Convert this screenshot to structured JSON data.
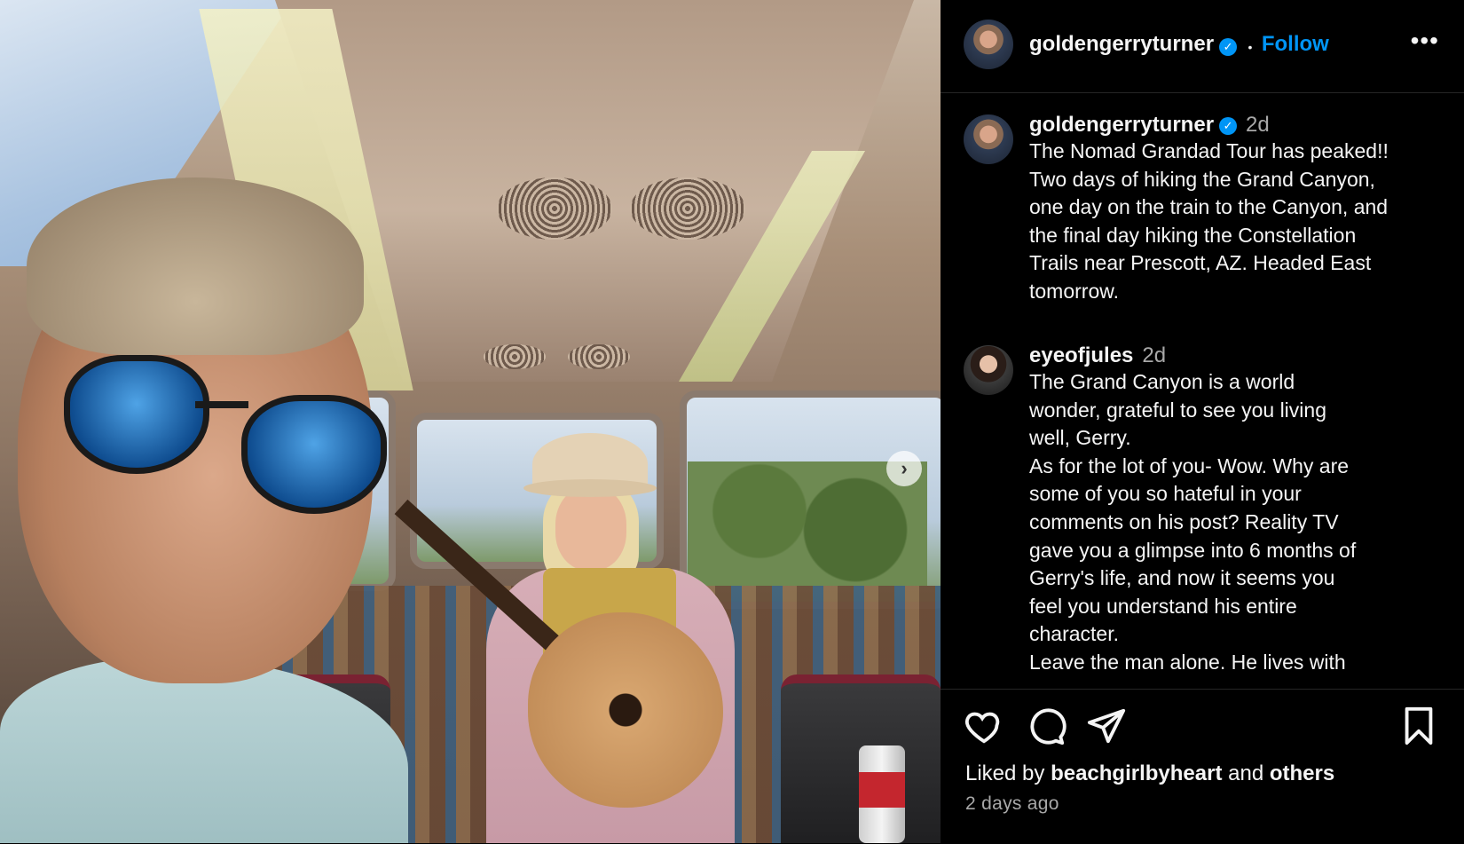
{
  "header": {
    "username": "goldengerryturner",
    "follow_label": "Follow",
    "separator": "•",
    "more_label": "•••"
  },
  "post": {
    "caption": {
      "username": "goldengerryturner",
      "time": "2d",
      "text": "The Nomad Grandad Tour has peaked!!\nTwo days of hiking the Grand Canyon,\none day on the train to the Canyon, and\nthe final day hiking the Constellation\nTrails near Prescott, AZ. Headed East\ntomorrow."
    },
    "comment": {
      "username": "eyeofjules",
      "time": "2d",
      "text": "The Grand Canyon is a world\nwonder, grateful to see you living\nwell, Gerry.\nAs for the lot of you- Wow. Why are\nsome of you so hateful in your\ncomments on his post? Reality TV\ngave you a glimpse into 6 months of\nGerry's life, and now it seems you\nfeel you understand his entire\ncharacter.\nLeave the man alone. He lives with"
    }
  },
  "footer": {
    "liked_prefix": "Liked by",
    "liked_user": "beachgirlbyheart",
    "liked_and": "and",
    "liked_others": "others",
    "time_ago": "2 days ago"
  },
  "icons": {
    "verified": "verified-badge-icon",
    "like": "heart-icon",
    "comment": "comment-bubble-icon",
    "share": "paper-plane-icon",
    "save": "bookmark-icon",
    "next": "chevron-right-icon",
    "comment_like": "heart-icon"
  },
  "colors": {
    "accent": "#0095f6",
    "background": "#000000",
    "text": "#f5f5f5",
    "muted": "#a8a8a8"
  },
  "media": {
    "next_glyph": "›"
  }
}
